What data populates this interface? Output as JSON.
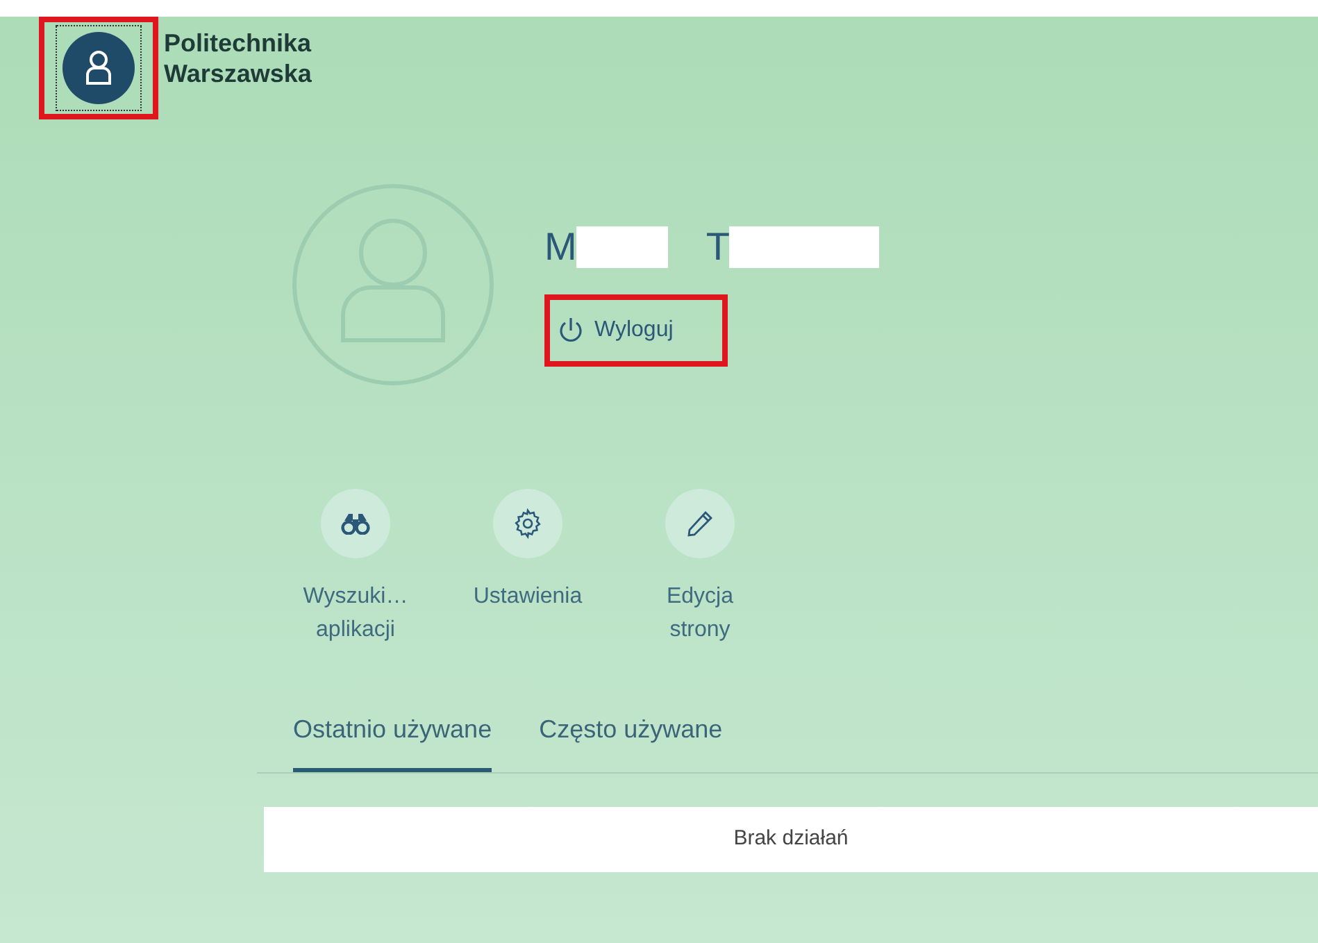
{
  "header": {
    "avatar_button": {
      "highlighted": true
    },
    "logo_lines": [
      "Politechnika",
      "Warszawska"
    ]
  },
  "profile": {
    "name_parts": [
      {
        "initial": "M",
        "redacted": true
      },
      {
        "initial": "T",
        "redacted": true
      }
    ],
    "logout": {
      "label": "Wyloguj",
      "highlighted": true
    }
  },
  "actions": [
    {
      "kind": "binoculars",
      "label_lines": [
        "Wyszuki…",
        "aplikacji"
      ]
    },
    {
      "kind": "gear",
      "label_lines": [
        "Ustawienia"
      ]
    },
    {
      "kind": "pencil",
      "label_lines": [
        "Edycja",
        "strony"
      ]
    }
  ],
  "tabs": [
    {
      "label": "Ostatnio używane",
      "selected": true
    },
    {
      "label": "Często używane",
      "selected": false
    }
  ],
  "list": {
    "empty_text": "Brak działań"
  }
}
